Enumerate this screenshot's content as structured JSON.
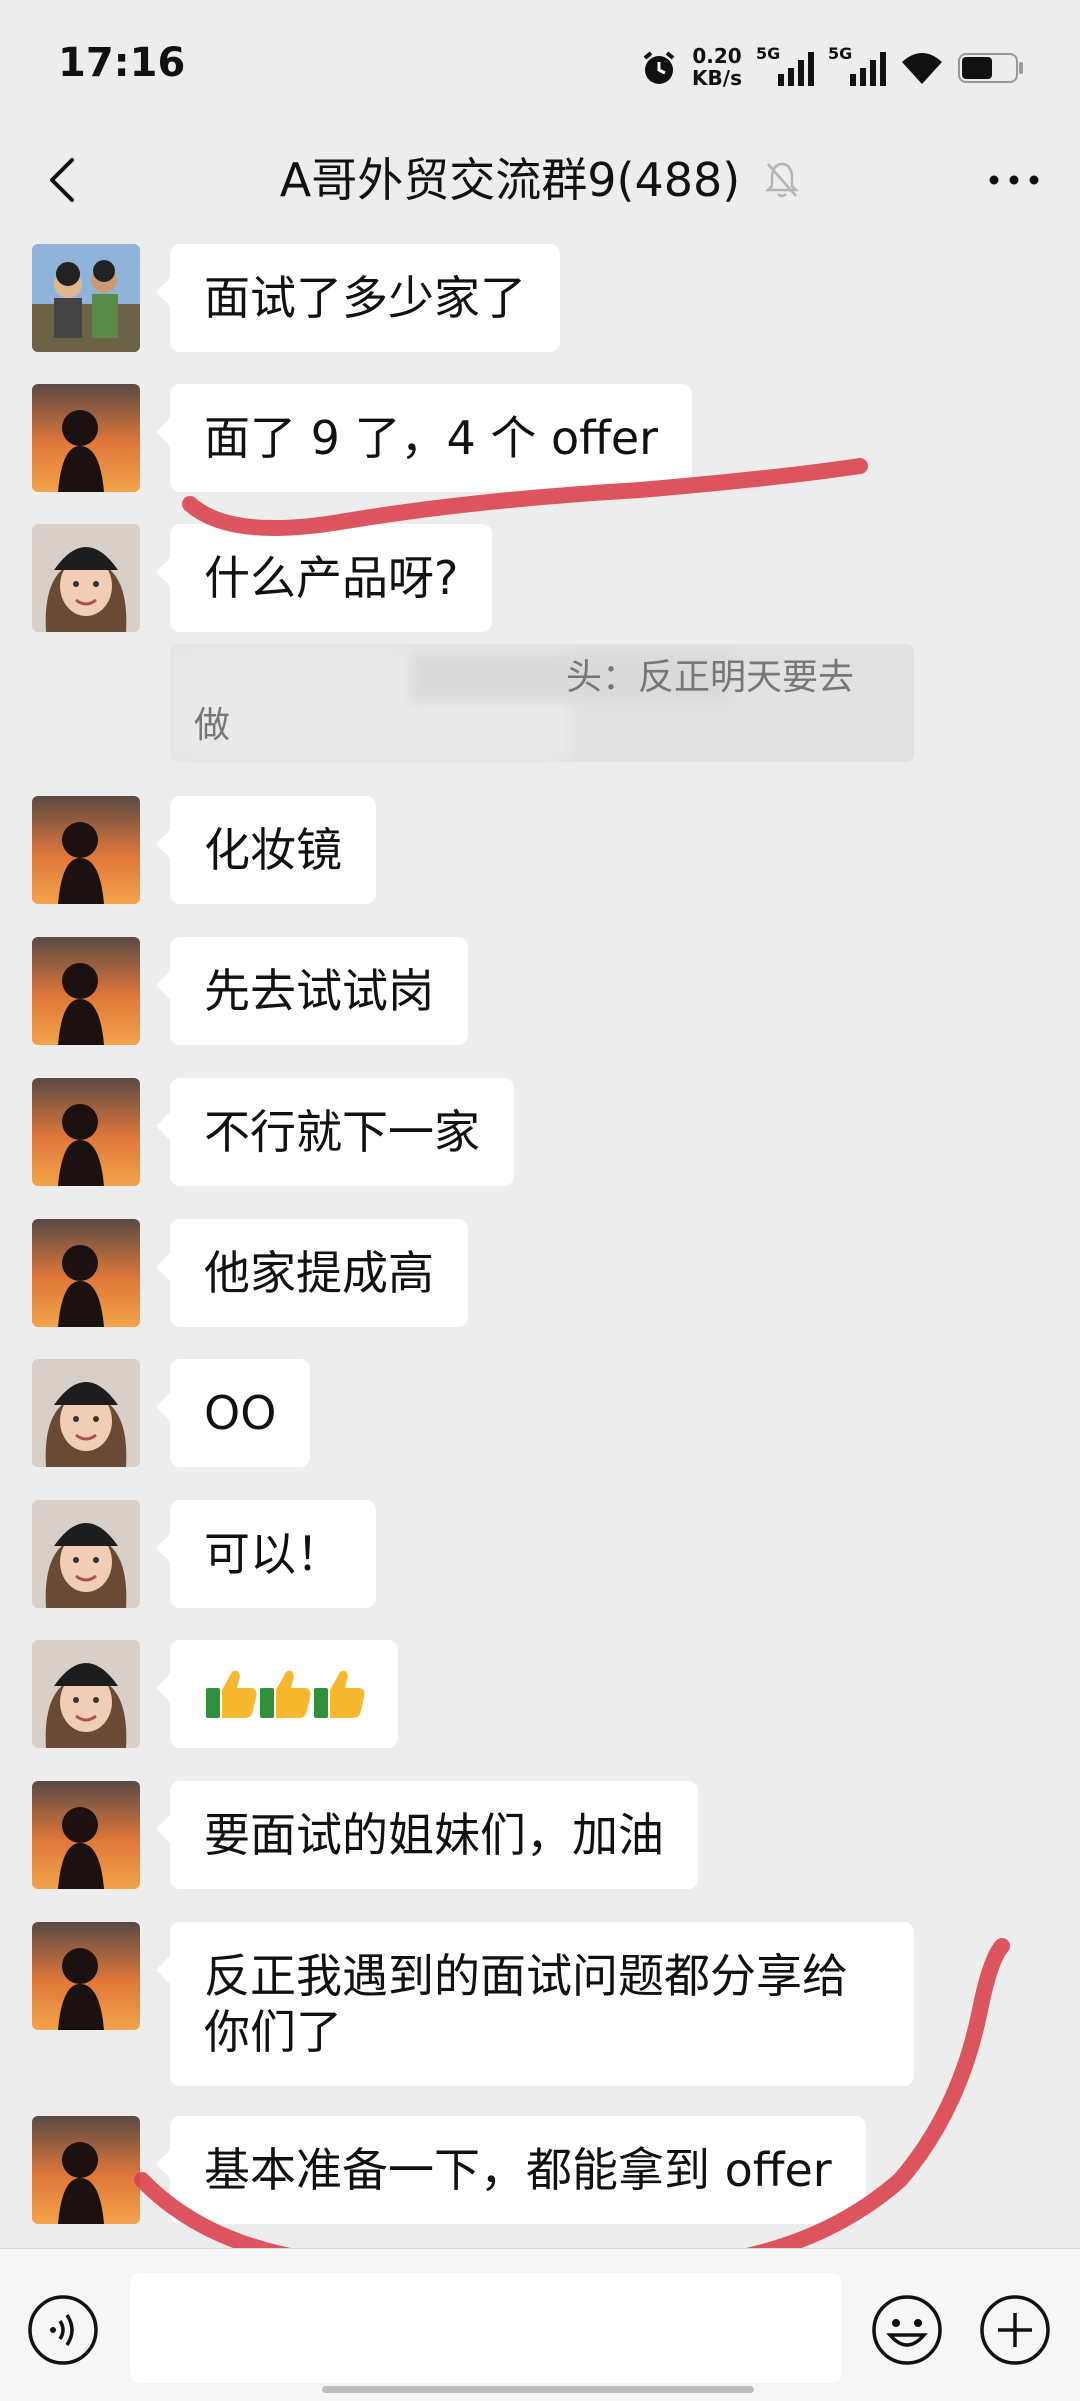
{
  "status_bar": {
    "time": "17:16",
    "net_speed_value": "0.20",
    "net_speed_unit": "KB/s",
    "signal1_label": "5G",
    "signal2_label": "5G"
  },
  "header": {
    "title": "A哥外贸交流群9(488)"
  },
  "messages": [
    {
      "text": "面试了多少家了"
    },
    {
      "text": "面了 9 了，4 个 offer"
    },
    {
      "text": "什么产品呀?"
    },
    {
      "text": "化妆镜"
    },
    {
      "text": "先去试试岗"
    },
    {
      "text": "不行就下一家"
    },
    {
      "text": "他家提成高"
    },
    {
      "text": "OO"
    },
    {
      "text": "可以！"
    },
    {
      "text": ""
    },
    {
      "text": "要面试的姐妹们，加油"
    },
    {
      "text": "反正我遇到的面试问题都分享给你们了"
    },
    {
      "text": "基本准备一下，都能拿到 offer"
    }
  ],
  "quote": {
    "line1": "头：反正明天要去",
    "line2": "做"
  },
  "colors": {
    "background": "#ededed",
    "bubble": "#ffffff",
    "annotation_red": "#d9434e"
  }
}
